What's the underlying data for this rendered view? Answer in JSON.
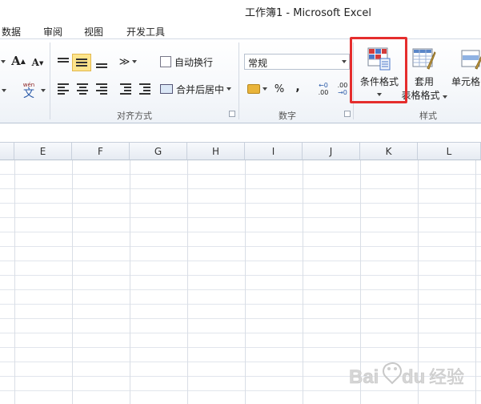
{
  "window": {
    "title": "工作簿1  -  Microsoft Excel"
  },
  "tabs": [
    "数据",
    "审阅",
    "视图",
    "开发工具"
  ],
  "ribbon": {
    "font_grow": "A",
    "font_shrink": "A",
    "phonetic": "文",
    "phonetic_top": "wén",
    "wrap_text": "自动换行",
    "merge_center": "合并后居中",
    "number_format": "常规",
    "percent": "%",
    "comma": ",",
    "inc_decimal": ".00",
    "dec_decimal": ".00",
    "conditional_format": "条件格式",
    "table_format_line1": "套用",
    "table_format_line2": "表格格式",
    "cell_styles": "单元格",
    "groups": {
      "alignment": "对齐方式",
      "number": "数字",
      "styles": "样式"
    }
  },
  "columns": [
    "E",
    "F",
    "G",
    "H",
    "I",
    "J",
    "K",
    "L"
  ],
  "watermark": "Bai du 经验"
}
